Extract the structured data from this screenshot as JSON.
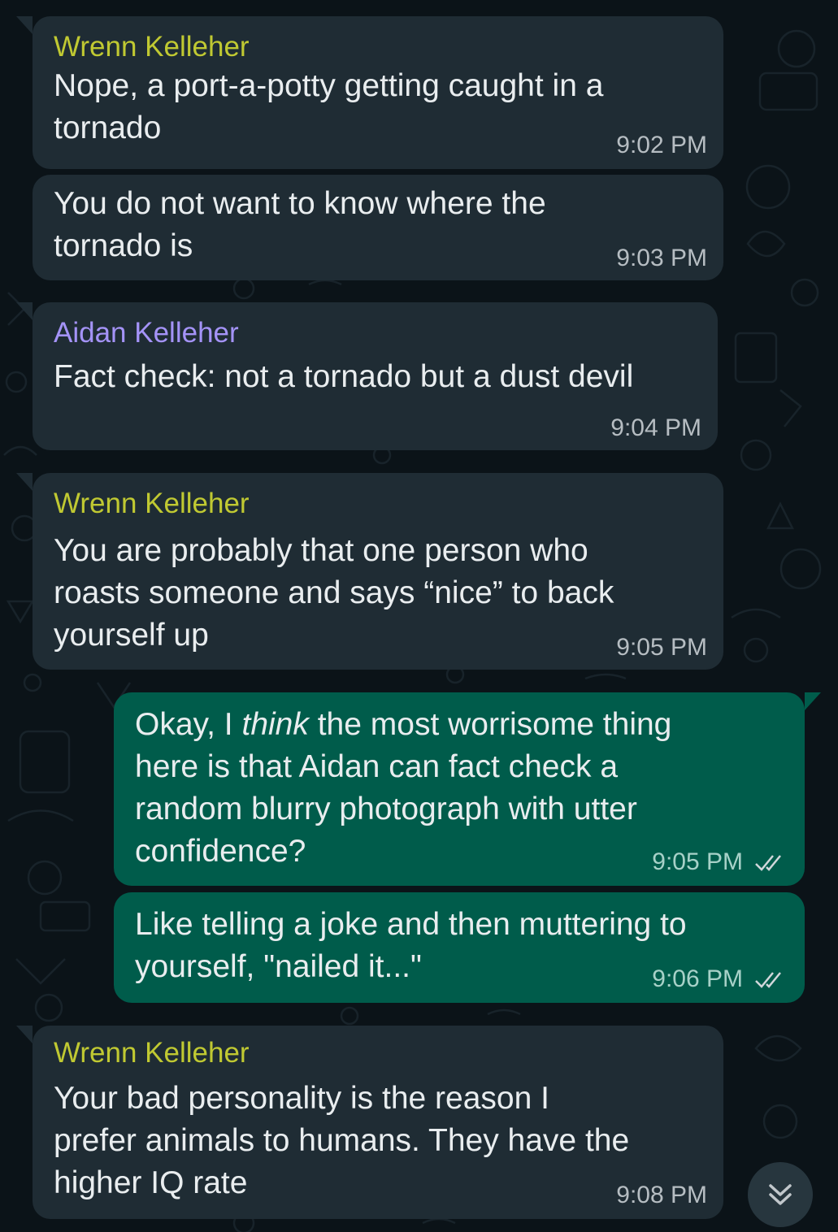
{
  "colors": {
    "background": "#0b1318",
    "incoming_bubble": "#1f2c34",
    "outgoing_bubble": "#005c4b",
    "wrenn_name": "#c0c932",
    "aidan_name": "#a493f7",
    "read_ticks": "#d1d7db"
  },
  "messages": [
    {
      "direction": "incoming",
      "sender": "Wrenn Kelleher",
      "lines": [
        "Nope, a port-a-potty getting caught in a",
        "tornado"
      ],
      "time": "9:02 PM"
    },
    {
      "direction": "incoming",
      "sender": "",
      "lines": [
        "You do not want to know where the",
        "tornado is"
      ],
      "time": "9:03 PM"
    },
    {
      "direction": "incoming",
      "sender": "Aidan Kelleher",
      "lines": [
        "Fact check: not a tornado but a dust devil"
      ],
      "time": "9:04 PM"
    },
    {
      "direction": "incoming",
      "sender": "Wrenn Kelleher",
      "lines": [
        "You are probably that one person who",
        "roasts someone and says “nice” to back",
        "yourself up"
      ],
      "time": "9:05 PM"
    },
    {
      "direction": "outgoing",
      "sender": "",
      "lines": [
        "Okay, I ",
        "think",
        " the most worrisome thing",
        "here is that Aidan can fact check a",
        "random blurry photograph with utter",
        "confidence?"
      ],
      "time": "9:05 PM",
      "status": "read"
    },
    {
      "direction": "outgoing",
      "sender": "",
      "lines": [
        "Like telling a joke and then muttering to",
        "yourself, \"nailed it...\""
      ],
      "time": "9:06 PM",
      "status": "read"
    },
    {
      "direction": "incoming",
      "sender": "Wrenn Kelleher",
      "lines": [
        "Your bad personality is the reason I",
        "prefer animals to humans. They have the",
        "higher IQ rate"
      ],
      "time": "9:08 PM"
    }
  ],
  "scroll_button": {
    "icon": "double-chevron-down-icon"
  }
}
